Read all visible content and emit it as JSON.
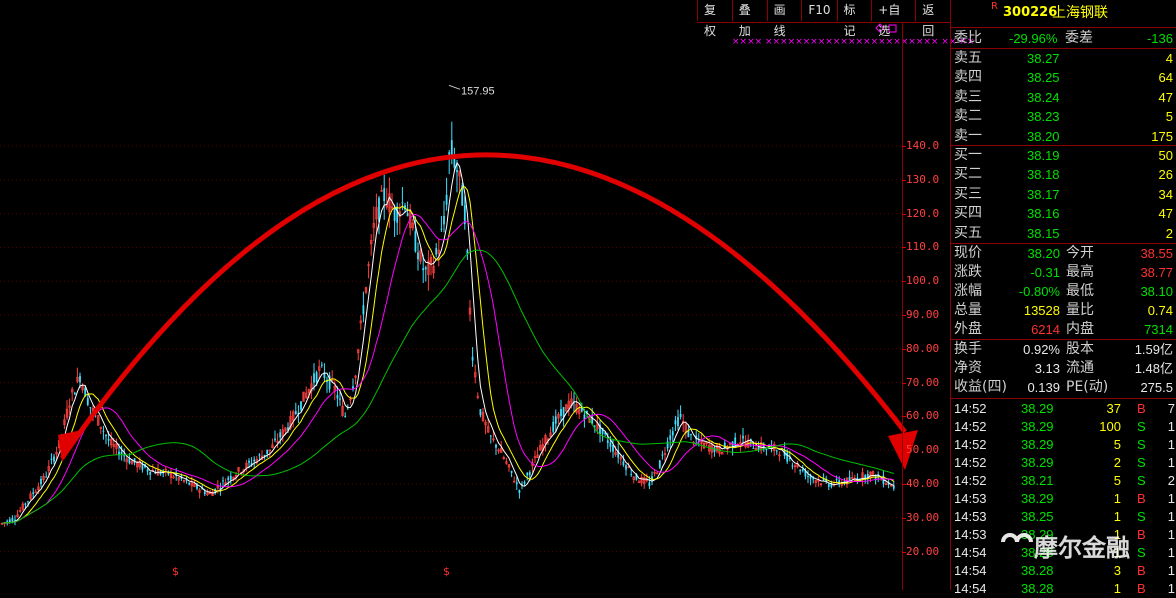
{
  "toolbar": {
    "buttons": [
      "复权",
      "叠加",
      "画线",
      "F10",
      "标记",
      "+自选",
      "返回"
    ]
  },
  "chart": {
    "y_ticks": [
      "140.0",
      "130.0",
      "120.0",
      "110.0",
      "100.0",
      "90.00",
      "80.00",
      "70.00",
      "60.00",
      "50.00",
      "40.00",
      "30.00",
      "20.00"
    ],
    "peak_label": "157.95",
    "markers": [
      "$",
      "$"
    ],
    "flags": "×××× ××××××××××××××××××××××× ×× ××"
  },
  "quote": {
    "r_badge": "R",
    "code": "300226",
    "name": "上海钢联",
    "weibi_label": "委比",
    "weibi": "-29.96%",
    "weicha_label": "委差",
    "weicha": "-136",
    "asks": [
      {
        "label": "卖五",
        "price": "38.27",
        "vol": "4"
      },
      {
        "label": "卖四",
        "price": "38.25",
        "vol": "64"
      },
      {
        "label": "卖三",
        "price": "38.24",
        "vol": "47"
      },
      {
        "label": "卖二",
        "price": "38.23",
        "vol": "5"
      },
      {
        "label": "卖一",
        "price": "38.20",
        "vol": "175"
      }
    ],
    "bids": [
      {
        "label": "买一",
        "price": "38.19",
        "vol": "50"
      },
      {
        "label": "买二",
        "price": "38.18",
        "vol": "26"
      },
      {
        "label": "买三",
        "price": "38.17",
        "vol": "34"
      },
      {
        "label": "买四",
        "price": "38.16",
        "vol": "47"
      },
      {
        "label": "买五",
        "price": "38.15",
        "vol": "2"
      }
    ],
    "stats1": [
      {
        "l1": "现价",
        "v1": "38.20",
        "c1": "g",
        "l2": "今开",
        "v2": "38.55",
        "c2": "r"
      },
      {
        "l1": "涨跌",
        "v1": "-0.31",
        "c1": "g",
        "l2": "最高",
        "v2": "38.77",
        "c2": "r"
      },
      {
        "l1": "涨幅",
        "v1": "-0.80%",
        "c1": "g",
        "l2": "最低",
        "v2": "38.10",
        "c2": "g"
      },
      {
        "l1": "总量",
        "v1": "13528",
        "c1": "y",
        "l2": "量比",
        "v2": "0.74",
        "c2": "y"
      },
      {
        "l1": "外盘",
        "v1": "6214",
        "c1": "r",
        "l2": "内盘",
        "v2": "7314",
        "c2": "g"
      }
    ],
    "stats2": [
      {
        "l1": "换手",
        "v1": "0.92%",
        "l2": "股本",
        "v2": "1.59亿"
      },
      {
        "l1": "净资",
        "v1": "3.13",
        "l2": "流通",
        "v2": "1.48亿"
      },
      {
        "l1": "收益(四)",
        "v1": "0.139",
        "l2": "PE(动)",
        "v2": "275.5"
      }
    ],
    "ticks": [
      {
        "t": "14:52",
        "p": "38.29",
        "v": "37",
        "bs": "B",
        "n": "7"
      },
      {
        "t": "14:52",
        "p": "38.29",
        "v": "100",
        "bs": "S",
        "n": "1"
      },
      {
        "t": "14:52",
        "p": "38.29",
        "v": "5",
        "bs": "S",
        "n": "1"
      },
      {
        "t": "14:52",
        "p": "38.29",
        "v": "2",
        "bs": "S",
        "n": "1"
      },
      {
        "t": "14:52",
        "p": "38.21",
        "v": "5",
        "bs": "S",
        "n": "2"
      },
      {
        "t": "14:53",
        "p": "38.29",
        "v": "1",
        "bs": "B",
        "n": "1"
      },
      {
        "t": "14:53",
        "p": "38.25",
        "v": "1",
        "bs": "S",
        "n": "1"
      },
      {
        "t": "14:53",
        "p": "38.29",
        "v": "1",
        "bs": "B",
        "n": "1"
      },
      {
        "t": "14:54",
        "p": "38.28",
        "v": "1",
        "bs": "S",
        "n": "1"
      },
      {
        "t": "14:54",
        "p": "38.28",
        "v": "3",
        "bs": "B",
        "n": "1"
      },
      {
        "t": "14:54",
        "p": "38.28",
        "v": "1",
        "bs": "B",
        "n": "1"
      }
    ]
  },
  "watermark": "摩尔金融",
  "colors": {
    "up": "#ff3030",
    "down": "#00e000",
    "grid": "#8b0000",
    "arrow": "#e00000"
  }
}
